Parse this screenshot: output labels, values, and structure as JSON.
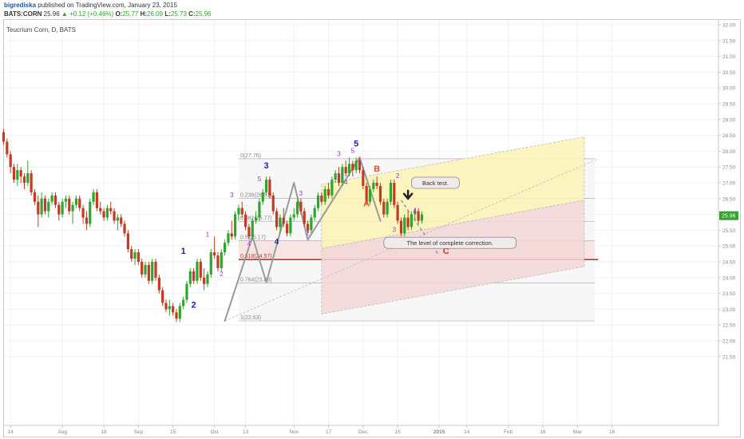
{
  "header": {
    "author": "bigrediska",
    "published": "published on TradingView.com, January 23, 2015",
    "symbol": "BATS:CORN",
    "last": "25.96",
    "change": "▲ +0.12 (+0.46%)",
    "o_label": "O:",
    "o_value": "25.77",
    "h_label": "H:",
    "h_value": "26.09",
    "l_label": "L:",
    "l_value": "25.73",
    "c_label": "C:",
    "c_value": "25.96"
  },
  "chart_title": "Teucrium Corn, D, BATS",
  "colors": {
    "up": "#2ea52b",
    "down": "#c23b22",
    "channel_yellow": "#fbf3b5",
    "channel_red": "#f3d7d7",
    "fib_red": "#c0392b",
    "wave_blue": "#1f1fa8",
    "wave_purple": "#9b30d8",
    "wave_orange": "#e0512b"
  },
  "chart_data": {
    "type": "candlestick",
    "title": "Teucrium Corn, D, BATS",
    "ylim": [
      21.25,
      32.05
    ],
    "y_ticks": [
      21.5,
      22.0,
      22.5,
      23.0,
      23.5,
      24.0,
      24.5,
      25.0,
      25.5,
      26.0,
      26.5,
      27.0,
      27.5,
      28.0,
      28.5,
      29.0,
      29.5,
      30.0,
      30.5,
      31.0,
      31.5,
      32.0
    ],
    "y_tick_labels": [
      "21.50",
      "22.00",
      "22.50",
      "23.00",
      "23.50",
      "24.00",
      "24.50",
      "25.00",
      "25.50",
      "26.00",
      "26.50",
      "27.00",
      "27.50",
      "28.00",
      "28.50",
      "29.00",
      "29.50",
      "30.00",
      "30.50",
      "31.00",
      "31.50",
      "32.00"
    ],
    "last_price_label": "25.96",
    "x_ticks": [
      {
        "label": "14",
        "i": 2
      },
      {
        "label": "Aug",
        "i": 17
      },
      {
        "label": "18",
        "i": 29
      },
      {
        "label": "Sep",
        "i": 39
      },
      {
        "label": "15",
        "i": 49
      },
      {
        "label": "Oct",
        "i": 61
      },
      {
        "label": "13",
        "i": 70
      },
      {
        "label": "Nov",
        "i": 84
      },
      {
        "label": "17",
        "i": 94
      },
      {
        "label": "Dec",
        "i": 104
      },
      {
        "label": "15",
        "i": 114
      },
      {
        "label": "2015",
        "i": 126
      },
      {
        "label": "14",
        "i": 134
      },
      {
        "label": "Feb",
        "i": 146
      },
      {
        "label": "16",
        "i": 156
      },
      {
        "label": "Mar",
        "i": 166
      },
      {
        "label": "16",
        "i": 176
      }
    ],
    "ohlc": [
      [
        28.6,
        28.7,
        28.2,
        28.3
      ],
      [
        28.3,
        28.4,
        27.8,
        27.9
      ],
      [
        27.9,
        28.0,
        27.3,
        27.5
      ],
      [
        27.5,
        27.6,
        27.0,
        27.1
      ],
      [
        27.1,
        27.6,
        26.9,
        27.4
      ],
      [
        27.4,
        27.5,
        27.0,
        27.2
      ],
      [
        27.2,
        27.3,
        26.8,
        27.0
      ],
      [
        27.0,
        27.7,
        26.9,
        27.3
      ],
      [
        27.3,
        27.4,
        26.6,
        26.7
      ],
      [
        26.7,
        26.8,
        26.3,
        26.4
      ],
      [
        26.4,
        26.6,
        25.6,
        26.0
      ],
      [
        26.0,
        26.7,
        25.9,
        26.5
      ],
      [
        26.5,
        26.6,
        26.0,
        26.1
      ],
      [
        26.1,
        26.5,
        25.9,
        26.4
      ],
      [
        26.4,
        26.7,
        26.3,
        26.6
      ],
      [
        26.6,
        26.7,
        26.2,
        26.3
      ],
      [
        26.3,
        26.4,
        25.8,
        26.0
      ],
      [
        26.0,
        26.5,
        25.9,
        26.4
      ],
      [
        26.4,
        26.6,
        26.2,
        26.5
      ],
      [
        26.5,
        26.6,
        26.0,
        26.1
      ],
      [
        26.1,
        26.4,
        25.7,
        26.3
      ],
      [
        26.3,
        26.6,
        26.2,
        26.5
      ],
      [
        26.5,
        26.6,
        26.1,
        26.2
      ],
      [
        26.2,
        26.3,
        25.7,
        25.9
      ],
      [
        25.9,
        26.1,
        25.5,
        25.7
      ],
      [
        25.7,
        26.5,
        25.6,
        26.4
      ],
      [
        26.4,
        26.8,
        26.3,
        26.7
      ],
      [
        26.7,
        26.8,
        26.1,
        26.2
      ],
      [
        26.2,
        26.4,
        26.0,
        26.1
      ],
      [
        26.1,
        26.2,
        25.8,
        25.9
      ],
      [
        25.9,
        26.3,
        25.8,
        26.2
      ],
      [
        26.2,
        26.4,
        26.0,
        26.1
      ],
      [
        26.1,
        26.2,
        25.7,
        25.8
      ],
      [
        25.8,
        26.0,
        25.5,
        25.9
      ],
      [
        25.9,
        26.0,
        25.6,
        25.7
      ],
      [
        25.7,
        25.8,
        25.3,
        25.4
      ],
      [
        25.4,
        25.5,
        24.8,
        24.9
      ],
      [
        24.9,
        25.0,
        24.5,
        24.6
      ],
      [
        24.6,
        24.9,
        24.4,
        24.8
      ],
      [
        24.8,
        24.9,
        24.4,
        24.5
      ],
      [
        24.5,
        24.6,
        24.0,
        24.1
      ],
      [
        24.1,
        24.5,
        24.0,
        24.4
      ],
      [
        24.4,
        24.5,
        23.8,
        23.9
      ],
      [
        23.9,
        24.6,
        23.8,
        24.5
      ],
      [
        24.5,
        24.6,
        23.9,
        24.0
      ],
      [
        24.0,
        24.1,
        23.5,
        23.6
      ],
      [
        23.6,
        23.7,
        23.1,
        23.2
      ],
      [
        23.2,
        23.3,
        22.9,
        23.0
      ],
      [
        23.0,
        23.3,
        22.8,
        23.1
      ],
      [
        23.1,
        23.2,
        22.8,
        22.9
      ],
      [
        22.9,
        23.0,
        22.6,
        22.7
      ],
      [
        22.7,
        23.2,
        22.6,
        23.1
      ],
      [
        23.1,
        23.4,
        23.0,
        23.3
      ],
      [
        23.3,
        23.9,
        23.2,
        23.8
      ],
      [
        23.8,
        24.3,
        23.7,
        24.2
      ],
      [
        24.2,
        24.3,
        23.8,
        23.9
      ],
      [
        23.9,
        24.6,
        23.8,
        24.5
      ],
      [
        24.5,
        24.6,
        23.9,
        24.0
      ],
      [
        24.0,
        24.3,
        23.6,
        23.8
      ],
      [
        23.8,
        24.2,
        23.7,
        24.1
      ],
      [
        24.1,
        24.9,
        24.0,
        24.8
      ],
      [
        24.8,
        25.3,
        24.6,
        24.7
      ],
      [
        24.7,
        24.8,
        24.2,
        24.3
      ],
      [
        24.3,
        24.9,
        24.2,
        24.8
      ],
      [
        24.8,
        25.2,
        24.7,
        25.1
      ],
      [
        25.1,
        25.5,
        25.0,
        25.4
      ],
      [
        25.4,
        25.8,
        25.2,
        25.3
      ],
      [
        25.3,
        26.1,
        25.2,
        26.0
      ],
      [
        26.0,
        26.3,
        25.8,
        26.2
      ],
      [
        26.2,
        26.4,
        25.9,
        26.0
      ],
      [
        26.0,
        26.1,
        25.5,
        25.6
      ],
      [
        25.6,
        25.7,
        25.2,
        25.3
      ],
      [
        25.3,
        25.9,
        25.2,
        25.8
      ],
      [
        25.8,
        26.1,
        25.7,
        25.9
      ],
      [
        25.9,
        26.5,
        25.8,
        26.4
      ],
      [
        26.4,
        26.8,
        26.3,
        26.7
      ],
      [
        26.7,
        27.2,
        26.6,
        27.1
      ],
      [
        27.1,
        27.2,
        26.5,
        26.6
      ],
      [
        26.6,
        26.7,
        26.0,
        26.1
      ],
      [
        26.1,
        26.2,
        25.5,
        25.6
      ],
      [
        25.6,
        26.0,
        25.4,
        25.9
      ],
      [
        25.9,
        26.2,
        25.6,
        25.7
      ],
      [
        25.7,
        25.8,
        25.3,
        25.4
      ],
      [
        25.4,
        26.0,
        25.3,
        25.9
      ],
      [
        25.9,
        26.2,
        25.8,
        26.0
      ],
      [
        26.0,
        26.5,
        25.9,
        26.4
      ],
      [
        26.4,
        26.5,
        26.0,
        26.1
      ],
      [
        26.1,
        26.2,
        25.6,
        25.7
      ],
      [
        25.7,
        25.8,
        25.4,
        25.5
      ],
      [
        25.5,
        26.0,
        25.4,
        25.9
      ],
      [
        25.9,
        26.3,
        25.8,
        26.2
      ],
      [
        26.2,
        26.7,
        26.1,
        26.6
      ],
      [
        26.6,
        26.7,
        26.3,
        26.4
      ],
      [
        26.4,
        26.9,
        26.3,
        26.8
      ],
      [
        26.8,
        27.0,
        26.5,
        26.6
      ],
      [
        26.6,
        27.2,
        26.5,
        27.1
      ],
      [
        27.1,
        27.4,
        27.0,
        27.3
      ],
      [
        27.3,
        27.5,
        26.9,
        27.0
      ],
      [
        27.0,
        27.6,
        26.9,
        27.5
      ],
      [
        27.5,
        27.7,
        27.2,
        27.3
      ],
      [
        27.3,
        27.8,
        27.2,
        27.6
      ],
      [
        27.6,
        27.7,
        27.2,
        27.4
      ],
      [
        27.4,
        27.8,
        27.3,
        27.7
      ],
      [
        27.7,
        27.8,
        27.3,
        27.4
      ],
      [
        27.4,
        27.5,
        26.8,
        26.9
      ],
      [
        26.9,
        27.0,
        26.3,
        26.4
      ],
      [
        26.4,
        26.9,
        26.3,
        26.8
      ],
      [
        26.8,
        27.1,
        26.7,
        27.0
      ],
      [
        27.0,
        27.2,
        26.8,
        26.9
      ],
      [
        26.9,
        27.0,
        26.3,
        26.4
      ],
      [
        26.4,
        26.5,
        25.9,
        26.0
      ],
      [
        26.0,
        26.5,
        25.9,
        26.4
      ],
      [
        26.4,
        27.1,
        26.3,
        27.0
      ],
      [
        27.0,
        27.1,
        26.2,
        26.3
      ],
      [
        26.3,
        26.4,
        25.7,
        25.8
      ],
      [
        25.8,
        25.9,
        25.3,
        25.4
      ],
      [
        25.4,
        26.0,
        25.3,
        25.9
      ],
      [
        25.9,
        26.1,
        25.5,
        25.6
      ],
      [
        25.6,
        26.1,
        25.5,
        26.0
      ],
      [
        26.0,
        26.2,
        25.8,
        26.1
      ],
      [
        26.1,
        26.2,
        25.7,
        25.8
      ],
      [
        25.8,
        26.1,
        25.7,
        26.0
      ]
    ],
    "fib_levels": [
      {
        "label": "0(27.76)",
        "value": 27.76
      },
      {
        "label": "0.236(26.51)",
        "value": 26.51
      },
      {
        "label": "0.382(25.77)",
        "value": 25.77
      },
      {
        "label": "0.5(25.17)",
        "value": 25.17
      },
      {
        "label": "0.618(24.57)",
        "value": 24.57
      },
      {
        "label": "0.764(23.83)",
        "value": 23.83
      },
      {
        "label": "1(22.63)",
        "value": 22.63
      }
    ],
    "wave_labels": [
      {
        "text": "1",
        "i": 52,
        "y": 24.75,
        "color": "blue",
        "size": 11
      },
      {
        "text": "2",
        "i": 55,
        "y": 23.05,
        "color": "blue",
        "size": 11
      },
      {
        "text": "3",
        "i": 76,
        "y": 27.45,
        "color": "blue",
        "size": 11
      },
      {
        "text": "4",
        "i": 79,
        "y": 25.05,
        "color": "blue",
        "size": 10
      },
      {
        "text": "5",
        "i": 102,
        "y": 28.15,
        "color": "blue",
        "size": 11
      },
      {
        "text": "1",
        "i": 59,
        "y": 25.3,
        "color": "purple",
        "size": 8
      },
      {
        "text": "2",
        "i": 63,
        "y": 24.05,
        "color": "purple",
        "size": 8
      },
      {
        "text": "3",
        "i": 66,
        "y": 26.55,
        "color": "purple",
        "size": 8
      },
      {
        "text": "4",
        "i": 71,
        "y": 25.0,
        "color": "purple",
        "size": 8
      },
      {
        "text": "5",
        "i": 74,
        "y": 27.05,
        "color": "purple",
        "size": 8
      },
      {
        "text": "3",
        "i": 86,
        "y": 26.6,
        "color": "purple",
        "size": 8
      },
      {
        "text": "2",
        "i": 88,
        "y": 25.35,
        "color": "purple",
        "size": 8
      },
      {
        "text": "3",
        "i": 97,
        "y": 27.85,
        "color": "purple",
        "size": 8
      },
      {
        "text": "4",
        "i": 99,
        "y": 26.95,
        "color": "purple",
        "size": 8
      },
      {
        "text": "5",
        "i": 101,
        "y": 27.95,
        "color": "purple",
        "size": 8
      },
      {
        "text": "A",
        "i": 105,
        "y": 26.25,
        "color": "orange",
        "size": 11
      },
      {
        "text": "B",
        "i": 108,
        "y": 27.35,
        "color": "orange",
        "size": 11
      },
      {
        "text": "1",
        "i": 110,
        "y": 26.0,
        "color": "purple",
        "size": 8
      },
      {
        "text": "2",
        "i": 114,
        "y": 27.15,
        "color": "purple",
        "size": 8
      },
      {
        "text": "3",
        "i": 113,
        "y": 25.45,
        "color": "purple",
        "size": 8
      },
      {
        "text": "4",
        "i": 119,
        "y": 26.05,
        "color": "purple",
        "size": 8
      },
      {
        "text": "5",
        "i": 124,
        "y": 25.05,
        "color": "purple",
        "size": 8
      },
      {
        "text": "C",
        "i": 128,
        "y": 24.75,
        "color": "red",
        "size": 11
      }
    ],
    "annotations": [
      {
        "text": "Back test.",
        "i": 118,
        "y": 26.95
      },
      {
        "text": "The level of complete correction.",
        "i": 110,
        "y": 25.05
      }
    ]
  }
}
